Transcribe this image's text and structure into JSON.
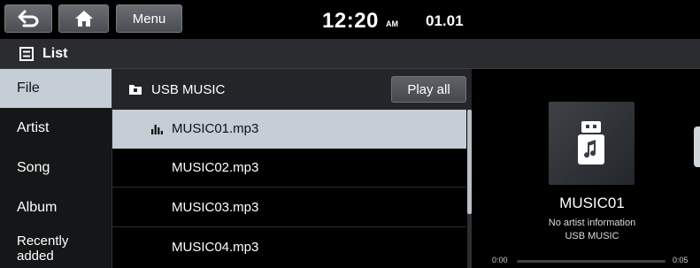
{
  "topbar": {
    "back_icon": "back-arrow-icon",
    "home_icon": "home-icon",
    "menu_label": "Menu",
    "time": "12:20",
    "ampm": "AM",
    "date": "01.01"
  },
  "list_header": {
    "icon": "list-icon",
    "title": "List"
  },
  "categories": [
    {
      "label": "File",
      "active": true
    },
    {
      "label": "Artist",
      "active": false
    },
    {
      "label": "Song",
      "active": false
    },
    {
      "label": "Album",
      "active": false
    },
    {
      "label": "Recently added",
      "active": false
    }
  ],
  "folder": {
    "icon": "usb-folder-icon",
    "name": "USB MUSIC",
    "play_all_label": "Play all"
  },
  "files": [
    {
      "name": "MUSIC01.mp3",
      "selected": true,
      "playing_icon": "equalizer-icon"
    },
    {
      "name": "MUSIC02.mp3",
      "selected": false
    },
    {
      "name": "MUSIC03.mp3",
      "selected": false
    },
    {
      "name": "MUSIC04.mp3",
      "selected": false
    }
  ],
  "now_playing": {
    "art_icon": "usb-music-icon",
    "title": "MUSIC01",
    "artist": "No artist information",
    "source": "USB MUSIC",
    "elapsed": "0:00",
    "duration": "0:05",
    "progress": 0
  },
  "colors": {
    "selection": "#c5cdd6",
    "header_bg": "#2a2c2f",
    "panel_bg": "#151617"
  }
}
